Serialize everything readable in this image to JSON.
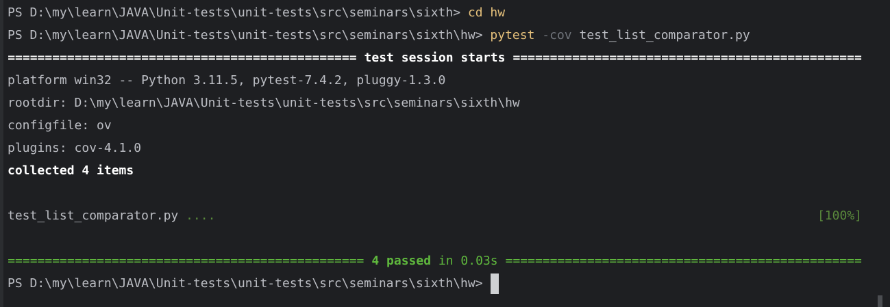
{
  "terminal": {
    "prompt_path": "PS D:\\my\\learn\\JAVA\\Unit-tests\\unit-tests\\src\\seminars\\sixth> ",
    "cmd1": "cd hw",
    "prompt_path_hw": "PS D:\\my\\learn\\JAVA\\Unit-tests\\unit-tests\\src\\seminars\\sixth\\hw> ",
    "cmd2_exec": "pytest",
    "cmd2_flag": "-cov",
    "cmd2_arg": "test_list_comparator.py",
    "rule_char_line": "========================================================================================================================",
    "session_title": "test session starts",
    "platform_line": "platform win32 -- Python 3.11.5, pytest-7.4.2, pluggy-1.3.0",
    "rootdir_line": "rootdir: D:\\my\\learn\\JAVA\\Unit-tests\\unit-tests\\src\\seminars\\sixth\\hw",
    "configfile_line": "configfile: ov",
    "plugins_line": "plugins: cov-4.1.0",
    "collected_line": "collected 4 items",
    "test_file": "test_list_comparator.py",
    "test_dots": "....",
    "progress": "[100%]",
    "passed_count": "4 passed",
    "passed_time": "in 0.03s",
    "final_prompt": "PS D:\\my\\learn\\JAVA\\Unit-tests\\unit-tests\\src\\seminars\\sixth\\hw>"
  },
  "colors": {
    "background": "#1e1f22",
    "text": "#bcbec4",
    "command": "#e5c07b",
    "flag": "#6f737a",
    "pass": "#5fb83d"
  }
}
